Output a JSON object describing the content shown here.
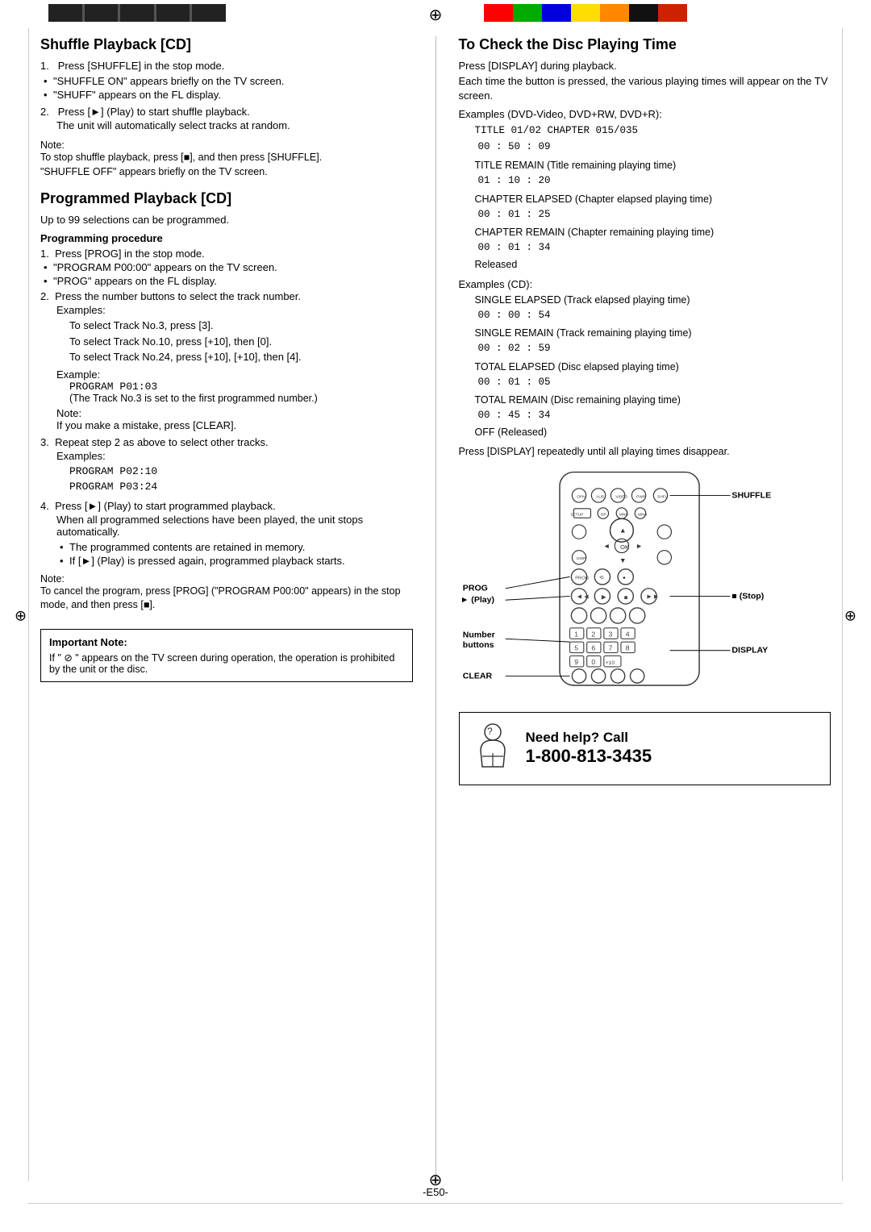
{
  "header": {
    "black_segments": 5,
    "colors": [
      "#ff0000",
      "#00aa00",
      "#0000ff",
      "#ffff00",
      "#ff8800",
      "#000000",
      "#cc0000"
    ]
  },
  "page_number": "-E50-",
  "left_column": {
    "section1": {
      "title": "Shuffle Playback [CD]",
      "steps": [
        {
          "num": "1.",
          "text": "Press [SHUFFLE] in the stop mode.",
          "bullets": [
            "\"SHUFFLE ON\" appears briefly on the TV screen.",
            "\"SHUFF\" appears on the FL display."
          ]
        },
        {
          "num": "2.",
          "text": "Press [►] (Play) to start shuffle playback.",
          "sub": "The unit will automatically select tracks at random."
        }
      ],
      "note_label": "Note:",
      "note_text": "To stop shuffle playback, press [■], and then press [SHUFFLE].\n\"SHUFFLE OFF\" appears briefly on the TV screen."
    },
    "section2": {
      "title": "Programmed Playback [CD]",
      "intro": "Up to 99 selections can be programmed.",
      "proc_title": "Programming procedure",
      "steps": [
        {
          "num": "1.",
          "text": "Press [PROG] in the stop mode.",
          "bullets": [
            "\"PROGRAM P00:00\" appears on the TV screen.",
            "\"PROG\" appears on the FL display."
          ]
        },
        {
          "num": "2.",
          "text": "Press the number buttons to select the track number.",
          "examples_label": "Examples:",
          "examples": [
            "To select Track No.3, press [3].",
            "To select Track No.10, press [+10], then [0].",
            "To select Track No.24, press [+10], [+10], then [4]."
          ],
          "example_label": "Example:",
          "example_lines": [
            "PROGRAM P01:03",
            "(The Track No.3 is set to the first programmed number.)"
          ],
          "note_label": "Note:",
          "note_text": "If you make a mistake, press [CLEAR]."
        },
        {
          "num": "3.",
          "text": "Repeat step 2 as above to select other tracks.",
          "examples_label": "Examples:",
          "examples2": [
            "PROGRAM P02:10",
            "PROGRAM P03:24"
          ]
        },
        {
          "num": "4.",
          "text": "Press [►] (Play) to start programmed playback.",
          "sub": "When all programmed selections have been played, the unit stops automatically.",
          "bullets": [
            "The programmed contents are retained in memory.",
            "If [►] (Play) is pressed again, programmed playback starts."
          ]
        }
      ],
      "note_label2": "Note:",
      "note_text2": "To cancel the program, press [PROG] (\"PROGRAM P00:00\" appears) in the stop mode, and then press [■]."
    },
    "important_note": {
      "title": "Important Note:",
      "text": "If \" ⊘ \" appears on the TV screen during operation, the operation is prohibited by the unit or the disc."
    }
  },
  "right_column": {
    "section_title": "To Check the Disc Playing Time",
    "intro1": "Press [DISPLAY] during playback.",
    "intro2": "Each time the button is pressed, the various playing times will appear on the TV screen.",
    "examples_dvd_label": "Examples (DVD-Video, DVD+RW, DVD+R):",
    "dvd_examples": [
      {
        "label": "TITLE 01/02  CHAPTER  015/035",
        "value": "00 : 50 : 09"
      },
      {
        "label": "TITLE REMAIN (Title remaining playing time)",
        "value": "01 : 10 : 20"
      },
      {
        "label": "CHAPTER ELAPSED (Chapter elapsed playing time)",
        "value": "00 : 01 : 25"
      },
      {
        "label": "CHAPTER REMAIN (Chapter remaining playing time)",
        "value": "00 : 01 : 34"
      },
      {
        "label": "Released",
        "value": ""
      }
    ],
    "examples_cd_label": "Examples (CD):",
    "cd_examples": [
      {
        "label": "SINGLE ELAPSED (Track elapsed playing time)",
        "value": "00 : 00 : 54"
      },
      {
        "label": "SINGLE REMAIN (Track remaining playing time)",
        "value": "00 : 02 : 59"
      },
      {
        "label": "TOTAL ELAPSED (Disc elapsed playing time)",
        "value": "00 : 01 : 05"
      },
      {
        "label": "TOTAL REMAIN (Disc remaining playing time)",
        "value": "00 : 45 : 34"
      },
      {
        "label": "OFF (Released)",
        "value": ""
      }
    ],
    "footer_note": "Press [DISPLAY] repeatedly until all playing times disappear.",
    "remote_labels": {
      "shuffle": "SHUFFLE",
      "prog": "PROG",
      "play": "► (Play)",
      "stop": "■ (Stop)",
      "number": "Number",
      "buttons": "buttons",
      "clear": "CLEAR",
      "display": "DISPLAY"
    },
    "need_help": {
      "title": "Need help? Call",
      "number": "1-800-813-3435"
    }
  }
}
